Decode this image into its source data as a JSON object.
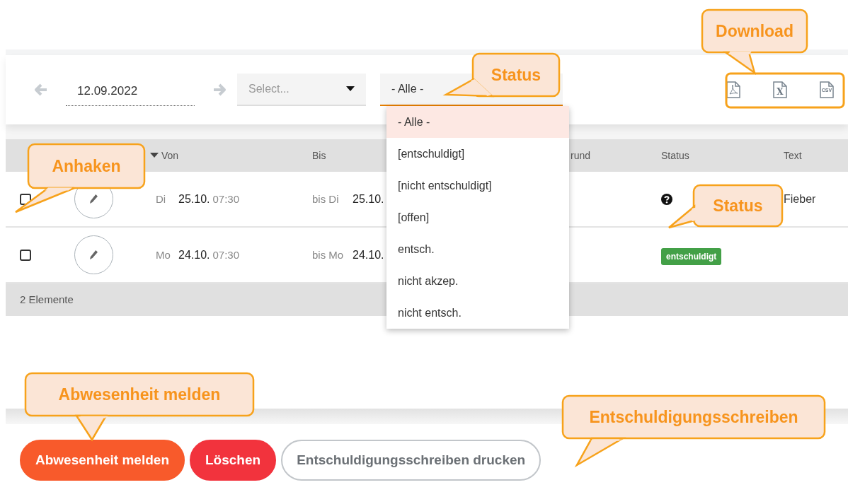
{
  "toolbar": {
    "date": "12.09.2022",
    "select_placeholder": "Select...",
    "status_value": "- Alle -"
  },
  "downloads": [
    {
      "kind": "pdf"
    },
    {
      "kind": "excel",
      "label": "X"
    },
    {
      "kind": "csv",
      "label": "CSV"
    }
  ],
  "status_dropdown": {
    "expanded": true,
    "options": [
      {
        "label": "- Alle -",
        "selected": true
      },
      {
        "label": "[entschuldigt]",
        "selected": false
      },
      {
        "label": "[nicht entschuldigt]",
        "selected": false
      },
      {
        "label": "[offen]",
        "selected": false
      },
      {
        "label": "entsch.",
        "selected": false
      },
      {
        "label": "nicht akzep.",
        "selected": false
      },
      {
        "label": "nicht entsch.",
        "selected": false
      }
    ]
  },
  "table": {
    "columns": [
      {
        "label": "Von",
        "sorted": true
      },
      {
        "label": "Bis",
        "sorted": false
      },
      {
        "label": "rund",
        "sorted": false
      },
      {
        "label": "Status",
        "sorted": false
      },
      {
        "label": "Text",
        "sorted": false
      }
    ],
    "rows": [
      {
        "checked": false,
        "from_day": "Di",
        "from_date": "25.10.",
        "from_time": "07:30",
        "to_day": "bis Di",
        "to_date": "25.10.",
        "status": {
          "kind": "unknown"
        },
        "text": "Fieber"
      },
      {
        "checked": false,
        "from_day": "Mo",
        "from_date": "24.10.",
        "from_time": "07:30",
        "to_day": "bis Mo",
        "to_date": "24.10.",
        "status": {
          "kind": "badge",
          "label": "entschuldigt"
        }
      }
    ],
    "footer": "2 Elemente"
  },
  "buttons": [
    {
      "label": "Abwesenheit melden",
      "kind": "primary"
    },
    {
      "label": "Löschen",
      "kind": "danger"
    },
    {
      "label": "Entschuldigungsschreiben drucken",
      "kind": "outline"
    }
  ],
  "callouts": [
    {
      "text": "Download"
    },
    {
      "text": "Status"
    },
    {
      "text": "Anhaken"
    },
    {
      "text": "Status"
    },
    {
      "text": "Abwesenheit melden"
    },
    {
      "text": "Entschuldigungsschreiben"
    }
  ]
}
